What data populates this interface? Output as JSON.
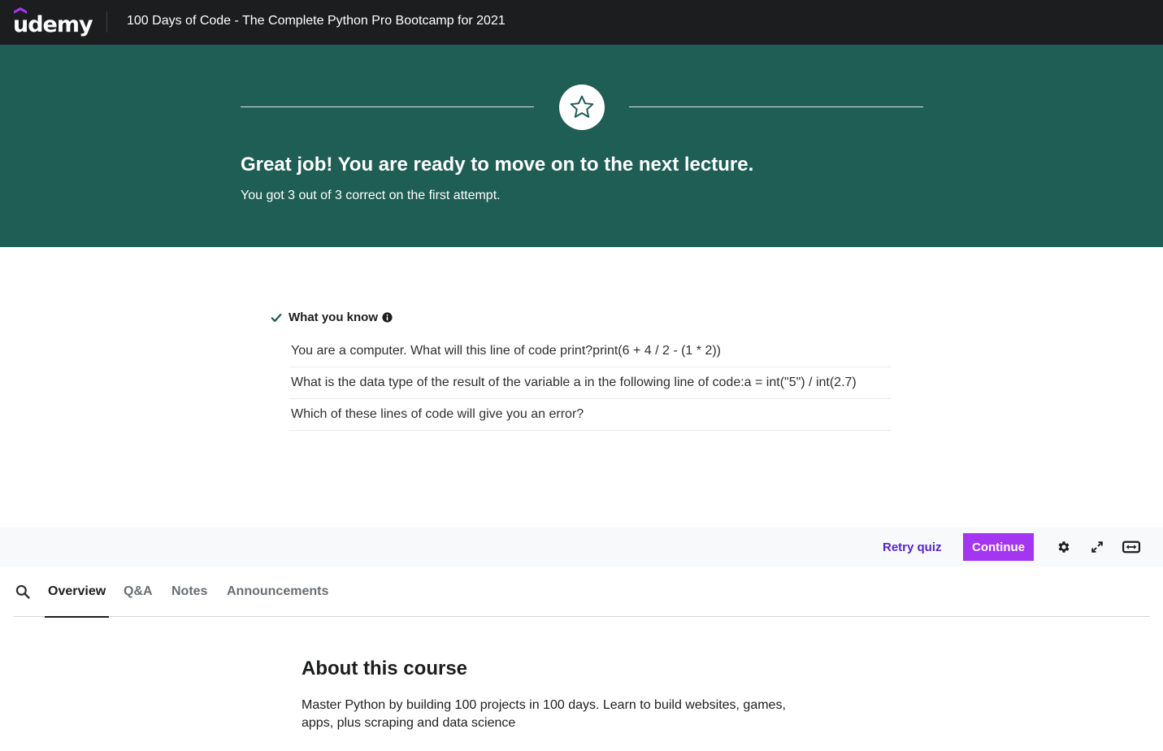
{
  "header": {
    "logo_text": "udemy",
    "course_title": "100 Days of Code - The Complete Python Pro Bootcamp for 2021"
  },
  "banner": {
    "heading": "Great job! You are ready to move on to the next lecture.",
    "subtext": "You got 3 out of 3 correct on the first attempt.",
    "icon": "star-icon"
  },
  "what_you_know": {
    "title": "What you know",
    "items": [
      "You are a computer. What will this line of code print?print(6 + 4 / 2 - (1 * 2))",
      "What is the data type of the result of the variable a in the following line of code:a = int(\"5\") / int(2.7)",
      "Which of these lines of code will give you an error?"
    ]
  },
  "controls": {
    "retry_label": "Retry quiz",
    "continue_label": "Continue",
    "icons": [
      "gear-icon",
      "expand-icon",
      "theater-mode-icon"
    ]
  },
  "tabs": {
    "items": [
      "Overview",
      "Q&A",
      "Notes",
      "Announcements"
    ],
    "active": "Overview"
  },
  "about": {
    "title": "About this course",
    "description": "Master Python by building 100 projects in 100 days. Learn to build websites, games, apps, plus scraping and data science"
  },
  "colors": {
    "topbar": "#1c1d1f",
    "banner": "#1e5e54",
    "accent_purple": "#a435f0",
    "link_purple": "#5624d0",
    "check_green": "#1e6055"
  }
}
